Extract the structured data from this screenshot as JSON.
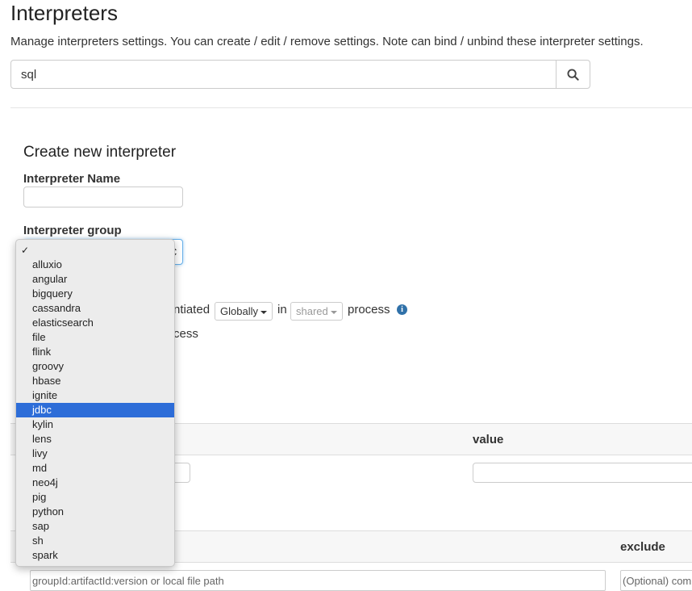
{
  "header": {
    "title": "Interpreters",
    "description": "Manage interpreters settings. You can create / edit / remove settings. Note can bind / unbind these interpreter settings.",
    "search_value": "sql"
  },
  "create": {
    "title": "Create new interpreter",
    "name_label": "Interpreter Name",
    "group_label": "Interpreter group",
    "instantiated_text": "ntiated",
    "mode_value": "Globally",
    "in_text": "in",
    "shared_value": "shared",
    "process_text": "process",
    "process2_text": "cess"
  },
  "properties": {
    "value_header": "value"
  },
  "dependencies": {
    "exclude_header": "exclude",
    "artifact_placeholder": "groupId:artifactId:version or local file path",
    "exclude_placeholder": "(Optional) com"
  },
  "group_options": [
    "",
    "alluxio",
    "angular",
    "bigquery",
    "cassandra",
    "elasticsearch",
    "file",
    "flink",
    "groovy",
    "hbase",
    "ignite",
    "jdbc",
    "kylin",
    "lens",
    "livy",
    "md",
    "neo4j",
    "pig",
    "python",
    "sap",
    "sh",
    "spark"
  ],
  "group_selected": "jdbc",
  "group_checked": "",
  "colors": {
    "selection": "#2d6dd8",
    "info": "#3071a9",
    "focus_border": "#66afe9"
  },
  "icons": {
    "search": "search-icon",
    "info": "info-icon",
    "check": "checkmark-icon"
  }
}
